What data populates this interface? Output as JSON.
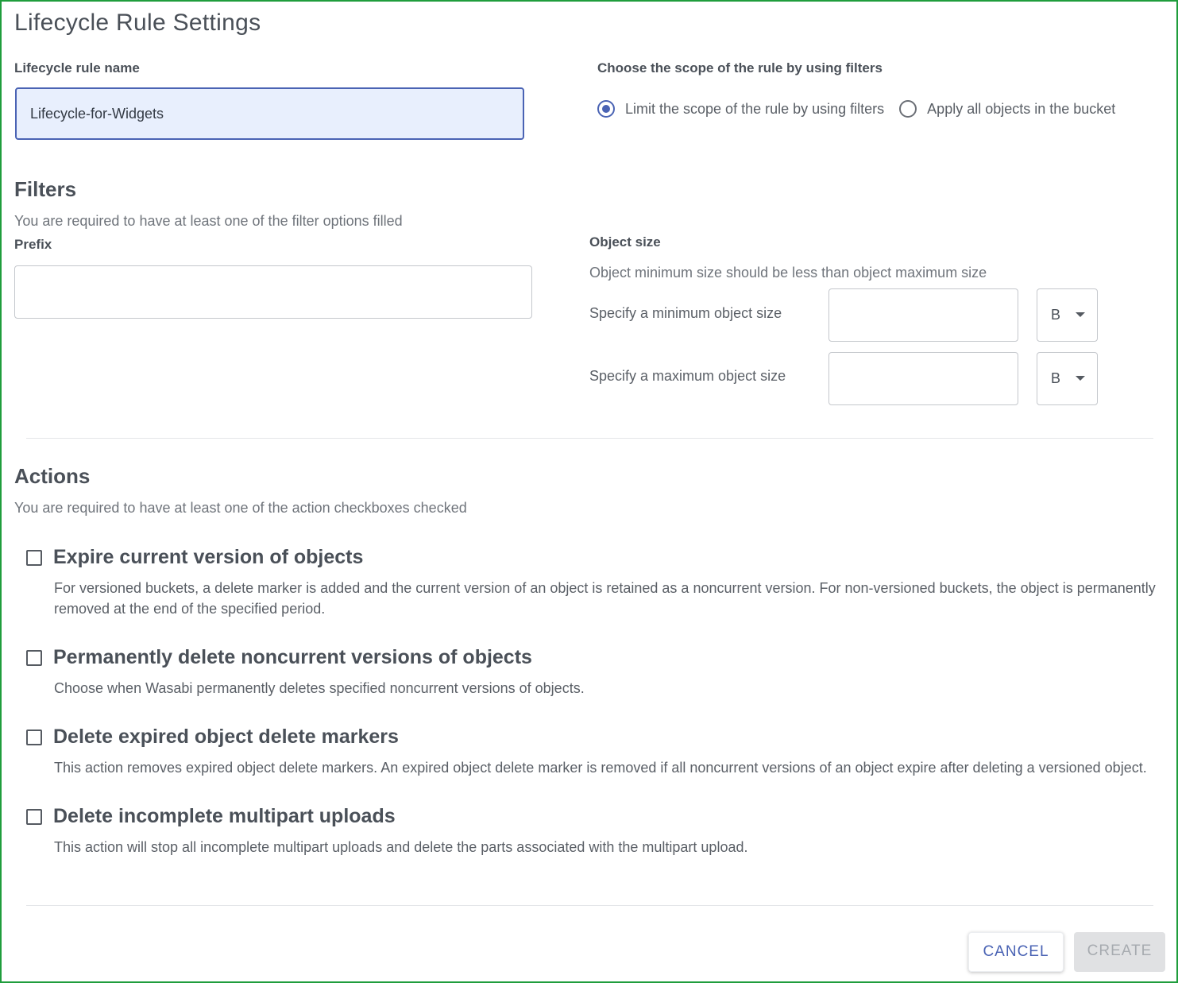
{
  "dialog": {
    "title": "Lifecycle Rule Settings"
  },
  "rule_name": {
    "label": "Lifecycle rule name",
    "value": "Lifecycle-for-Widgets"
  },
  "scope": {
    "label": "Choose the scope of the rule by using filters",
    "options": [
      {
        "label": "Limit the scope of the rule by using filters",
        "selected": true
      },
      {
        "label": "Apply all objects in the bucket",
        "selected": false
      }
    ]
  },
  "filters": {
    "heading": "Filters",
    "hint": "You are required to have at least one of the filter options filled",
    "prefix_label": "Prefix",
    "prefix_value": "",
    "object_size": {
      "label": "Object size",
      "hint": "Object minimum size should be less than object maximum size",
      "min_label": "Specify a minimum object size",
      "min_value": "",
      "min_unit": "B",
      "max_label": "Specify a maximum object size",
      "max_value": "",
      "max_unit": "B"
    }
  },
  "actions": {
    "heading": "Actions",
    "hint": "You are required to have at least one of the action checkboxes checked",
    "items": [
      {
        "title": "Expire current version of objects",
        "description_line1": "For versioned buckets, a delete marker is added and the current version of an object is retained as a noncurrent version. For non-versioned buckets, the object is permanently",
        "description_line2": "removed at the end of the specified period.",
        "checked": false
      },
      {
        "title": "Permanently delete noncurrent versions of objects",
        "description": "Choose when Wasabi permanently deletes specified noncurrent versions of objects.",
        "checked": false
      },
      {
        "title": "Delete expired object delete markers",
        "description": "This action removes expired object delete markers. An expired object delete marker is removed if all noncurrent versions of an object expire after deleting a versioned object.",
        "checked": false
      },
      {
        "title": "Delete incomplete multipart uploads",
        "description": "This action will stop all incomplete multipart uploads and delete the parts associated with the multipart upload.",
        "checked": false
      }
    ]
  },
  "footer": {
    "cancel_label": "CANCEL",
    "create_label": "CREATE",
    "create_enabled": false
  },
  "colors": {
    "accent": "#4a63b4",
    "frame_border": "#1f9d3c",
    "input_highlight": "#e8effd",
    "disabled_button": "#e0e1e3"
  }
}
